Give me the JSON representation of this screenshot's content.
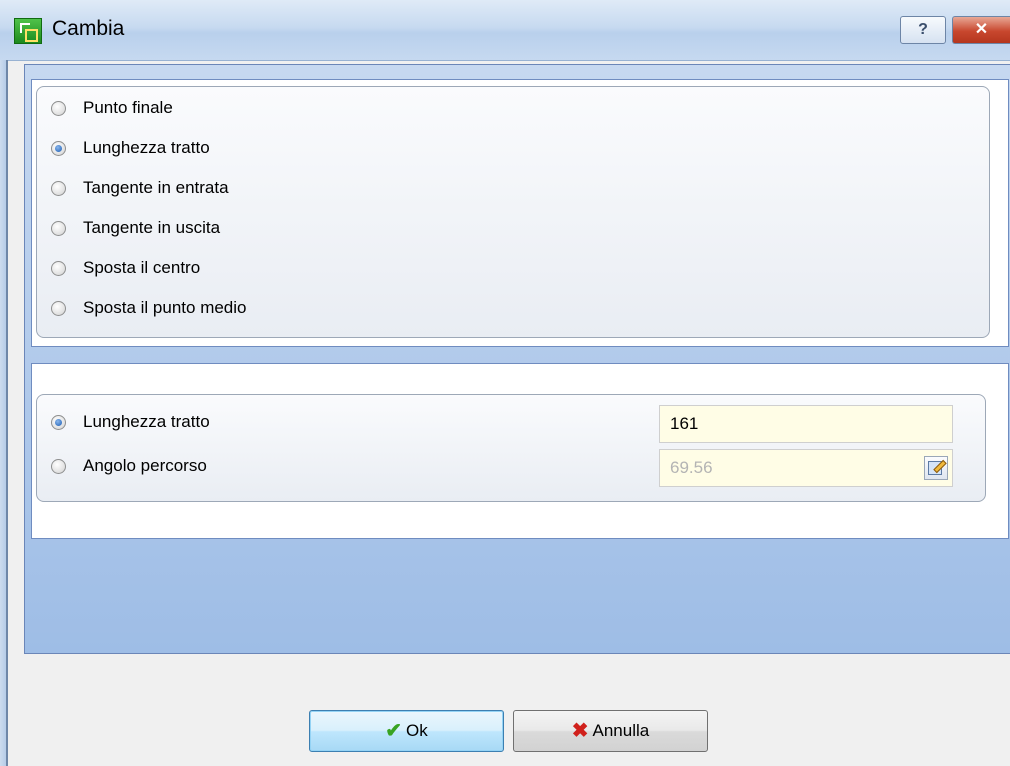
{
  "window": {
    "title": "Cambia",
    "help_label": "?",
    "close_label": "✕"
  },
  "modes": {
    "selected": "Lunghezza tratto",
    "options": [
      "Punto finale",
      "Lunghezza tratto",
      "Tangente in entrata",
      "Tangente in uscita",
      "Sposta il centro",
      "Sposta il punto medio"
    ]
  },
  "params": {
    "selected": "Lunghezza tratto",
    "length_label": "Lunghezza tratto",
    "length_value": "161",
    "angle_label": "Angolo percorso",
    "angle_value": "69.56"
  },
  "buttons": {
    "ok_label": "Ok",
    "cancel_label": "Annulla"
  },
  "colors": {
    "panel_top": "#c6d8f0",
    "panel_bottom": "#9ebde6",
    "field_bg": "#fffde6"
  }
}
